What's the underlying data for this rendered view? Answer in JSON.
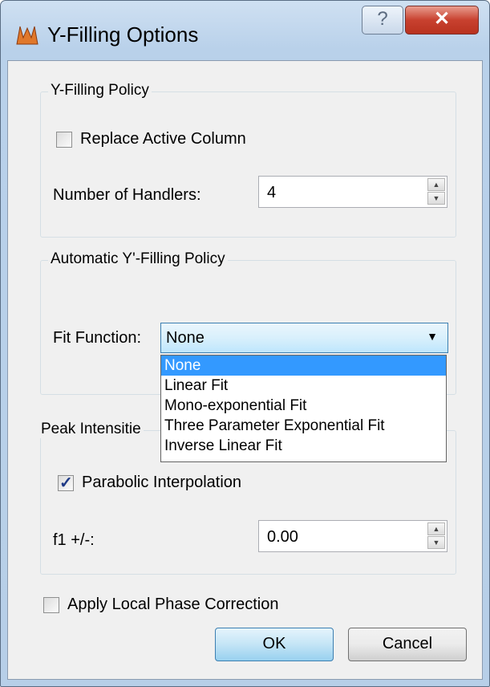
{
  "window": {
    "title": "Y-Filling Options",
    "help_glyph": "?",
    "close_glyph": "✕"
  },
  "y_filling_policy": {
    "title": "Y-Filling Policy",
    "replace_active_column": {
      "label": "Replace Active Column",
      "checked": false
    },
    "number_of_handlers": {
      "label": "Number of Handlers:",
      "value": "4"
    }
  },
  "automatic_policy": {
    "title": "Automatic Y'-Filling Policy",
    "fit_function": {
      "label": "Fit Function:",
      "value": "None",
      "options": [
        "None",
        "Linear Fit",
        "Mono-exponential Fit",
        "Three Parameter Exponential Fit",
        "Inverse Linear Fit"
      ]
    }
  },
  "peak_intensities": {
    "title": "Peak Intensitie",
    "parabolic_interpolation": {
      "label": "Parabolic Interpolation",
      "checked": true
    },
    "f1": {
      "label": "f1 +/-:",
      "value": "0.00"
    }
  },
  "apply_local_phase_correction": {
    "label": "Apply Local Phase Correction",
    "checked": false
  },
  "buttons": {
    "ok": "OK",
    "cancel": "Cancel"
  },
  "icons": {
    "app": "app-logo-icon",
    "checkmark": "✓",
    "spin_up": "▲",
    "spin_down": "▼",
    "dropdown": "▼"
  }
}
